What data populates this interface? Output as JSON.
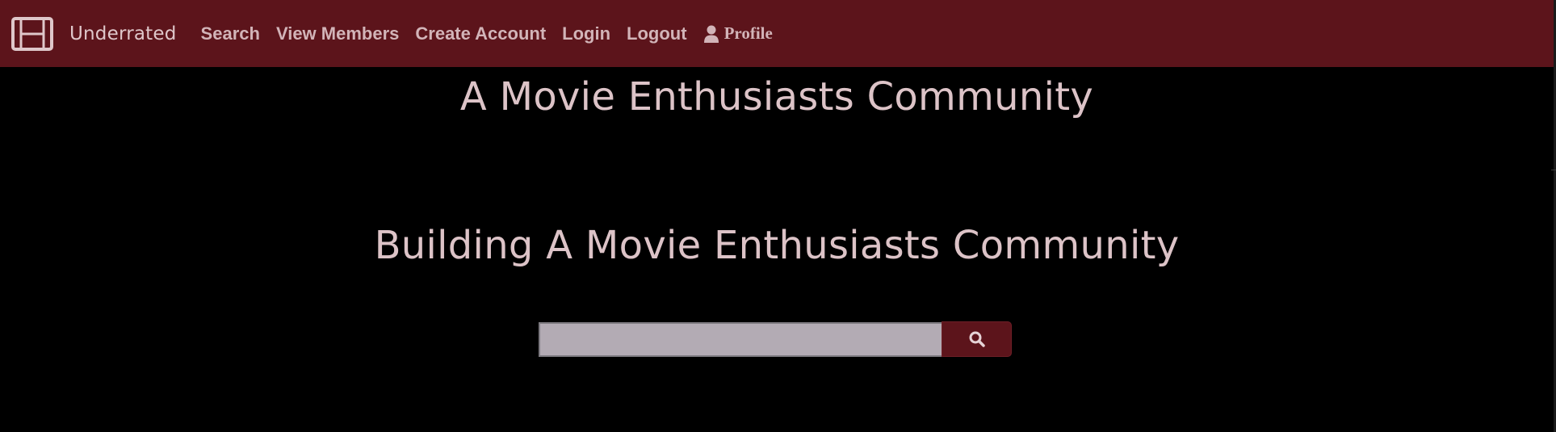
{
  "brand": {
    "name": "Underrated",
    "icon": "film-icon"
  },
  "nav": {
    "links": [
      {
        "label": "Search"
      },
      {
        "label": "View Members"
      },
      {
        "label": "Create Account"
      },
      {
        "label": "Login"
      },
      {
        "label": "Logout"
      }
    ],
    "profile": {
      "label": "Profile",
      "icon": "user-icon"
    }
  },
  "main": {
    "title": "A Movie Enthusiasts Community",
    "subtitle": "Building A Movie Enthusiasts Community"
  },
  "search": {
    "value": "",
    "placeholder": "",
    "button_icon": "search-icon"
  },
  "colors": {
    "navbar_bg": "#5c141b",
    "page_bg": "#000000",
    "heading_text": "#dcc3c7",
    "nav_text": "#d2b4b8",
    "search_input_bg": "#b3abb4"
  }
}
